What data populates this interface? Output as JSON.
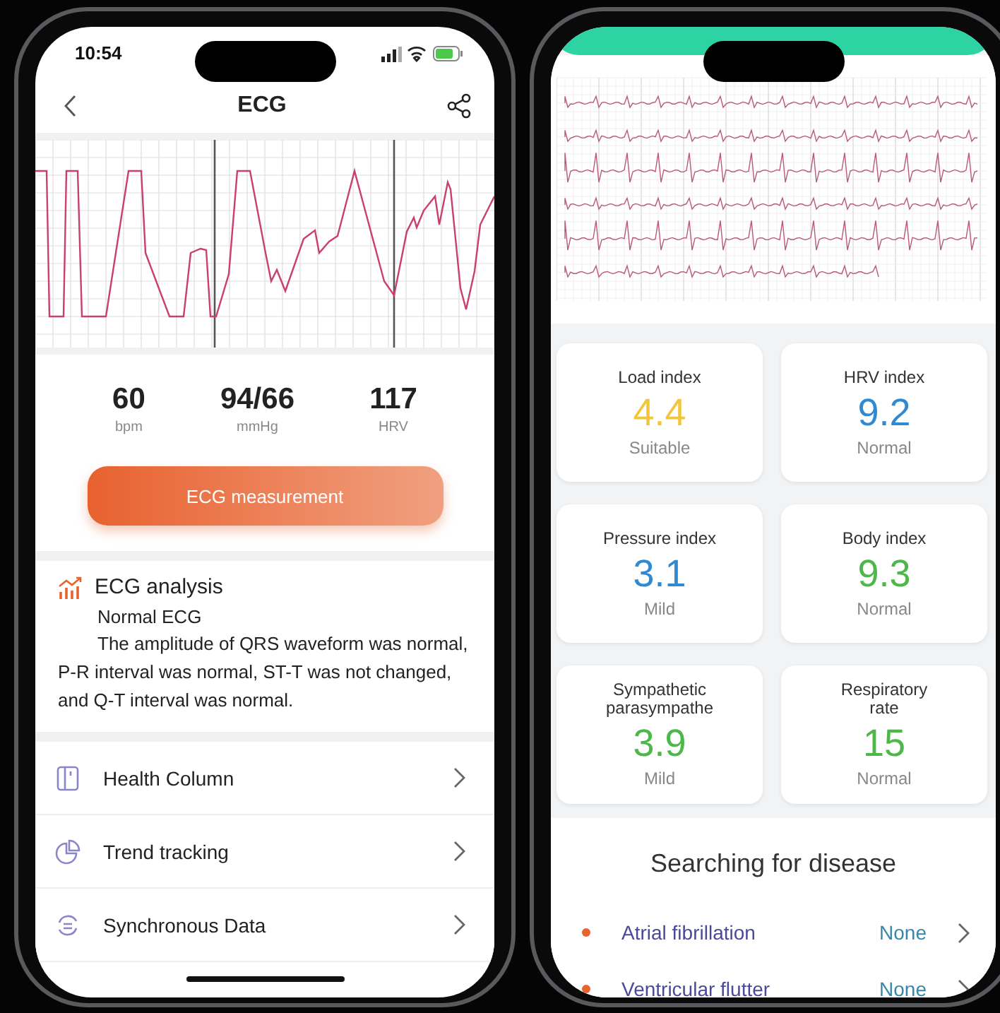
{
  "left_phone": {
    "status_bar": {
      "time": "10:54"
    },
    "header": {
      "title": "ECG"
    },
    "stats": [
      {
        "value": "60",
        "unit": "bpm"
      },
      {
        "value": "94/66",
        "unit": "mmHg"
      },
      {
        "value": "117",
        "unit": "HRV"
      }
    ],
    "measure_button": {
      "label": "ECG measurement"
    },
    "analysis": {
      "title": "ECG analysis",
      "result": "Normal ECG",
      "text": "The amplitude of QRS waveform was normal, P-R interval was normal, ST-T was not changed, and Q-T interval was normal."
    },
    "menu": [
      {
        "label": "Health Column",
        "kind": "column"
      },
      {
        "label": "Trend tracking",
        "kind": "pie"
      },
      {
        "label": "Synchronous Data",
        "kind": "sync"
      }
    ]
  },
  "right_phone": {
    "indices": [
      {
        "label": "Load index",
        "value": "4.4",
        "status": "Suitable",
        "color": "#f2c63c"
      },
      {
        "label": "HRV index",
        "value": "9.2",
        "status": "Normal",
        "color": "#2f8ad6"
      },
      {
        "label": "Pressure index",
        "value": "3.1",
        "status": "Mild",
        "color": "#2f8ad6"
      },
      {
        "label": "Body index",
        "value": "9.3",
        "status": "Normal",
        "color": "#4cb84a"
      },
      {
        "label": "Sympathetic parasympathe",
        "value": "3.9",
        "status": "Mild",
        "color": "#4cb84a"
      },
      {
        "label": "Respiratory rate",
        "value": "15",
        "status": "Normal",
        "color": "#4cb84a"
      }
    ],
    "disease_search": {
      "title": "Searching for disease",
      "items": [
        {
          "name": "Atrial fibrillation",
          "result": "None"
        },
        {
          "name": "Ventricular flutter",
          "result": "None"
        }
      ]
    }
  }
}
